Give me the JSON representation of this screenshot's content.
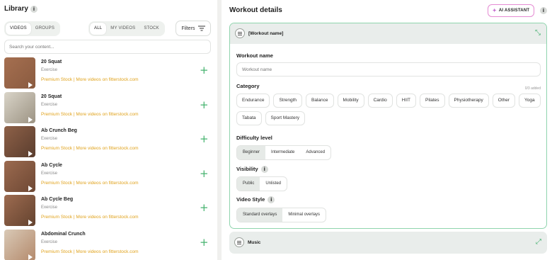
{
  "library": {
    "title": "Library",
    "view_tabs": [
      "VIDEOS",
      "GROUPS"
    ],
    "source_tabs": [
      "ALL",
      "MY VIDEOS",
      "STOCK"
    ],
    "filters_label": "Filters",
    "search_placeholder": "Search your content...",
    "items": [
      {
        "name": "20 Squat",
        "type": "Exercise",
        "link": "Premium Stock | More videos on fitterstock.com",
        "thumb": [
          "#a56f50",
          "#8a5b40"
        ]
      },
      {
        "name": "20 Squat",
        "type": "Exercise",
        "link": "Premium Stock | More videos on fitterstock.com",
        "thumb": [
          "#d9d4c8",
          "#9c9383"
        ]
      },
      {
        "name": "Ab Crunch Beg",
        "type": "Exercise",
        "link": "Premium Stock | More videos on fitterstock.com",
        "thumb": [
          "#8e6148",
          "#5a3d2e"
        ]
      },
      {
        "name": "Ab Cycle",
        "type": "Exercise",
        "link": "Premium Stock | More videos on fitterstock.com",
        "thumb": [
          "#9b6a4f",
          "#6e4834"
        ]
      },
      {
        "name": "Ab Cycle Beg",
        "type": "Exercise",
        "link": "Premium Stock | More videos on fitterstock.com",
        "thumb": [
          "#9d6b50",
          "#64432f"
        ]
      },
      {
        "name": "Abdominal Crunch",
        "type": "Exercise",
        "link": "Premium Stock | More videos on fitterstock.com",
        "thumb": [
          "#d9c9b6",
          "#b48a6c"
        ]
      }
    ]
  },
  "details": {
    "title": "Workout details",
    "ai_label": "AI ASSISTANT",
    "card_title": "[Workout name]",
    "name_label": "Workout name",
    "name_placeholder": "Workout name",
    "category_label": "Category",
    "category_count": "0/3 added",
    "categories": [
      "Endurance",
      "Strength",
      "Balance",
      "Mobility",
      "Cardio",
      "HIIT",
      "Pilates",
      "Physiotherapy",
      "Other",
      "Yoga",
      "Tabata",
      "Sport Mastery"
    ],
    "difficulty_label": "Difficulty level",
    "difficulty_options": [
      "Beginner",
      "Intermediate",
      "Advanced"
    ],
    "visibility_label": "Visibility",
    "visibility_options": [
      "Public",
      "Unlisted"
    ],
    "style_label": "Video Style",
    "style_options": [
      "Standard overlays",
      "Minimal overlays"
    ],
    "music_label": "Music"
  }
}
